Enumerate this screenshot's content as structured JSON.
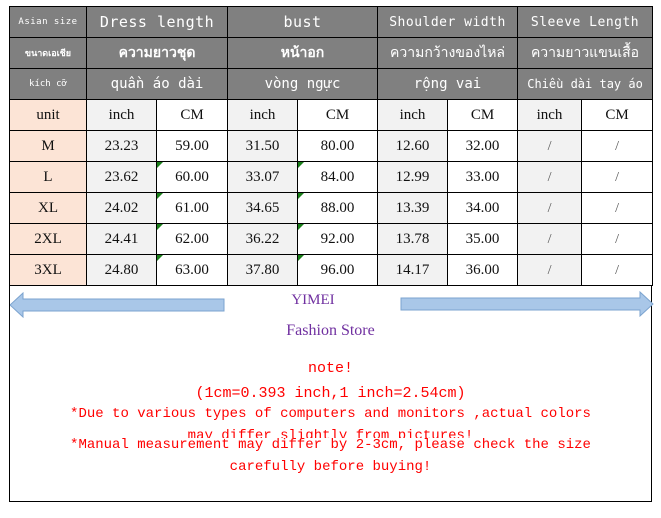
{
  "header": {
    "row1": {
      "label": "Asian size",
      "columns": [
        "Dress length",
        "bust",
        "Shoulder width",
        "Sleeve Length"
      ]
    },
    "row2": {
      "label": "ขนาดเอเชีย",
      "columns": [
        "ความยาวชุด",
        "หน้าอก",
        "ความกว้างของไหล่",
        "ความยาวแขนเสื้อ"
      ]
    },
    "row3": {
      "label": "kích cỡ",
      "columns": [
        "quần áo dài",
        "vòng ngực",
        "rộng vai",
        "Chiều dài tay áo"
      ]
    }
  },
  "units_row": [
    "unit",
    "inch",
    "CM",
    "inch",
    "CM",
    "inch",
    "CM",
    "inch",
    "CM"
  ],
  "rows": [
    {
      "size": "M",
      "values": [
        "23.23",
        "59.00",
        "31.50",
        "80.00",
        "12.60",
        "32.00",
        "/",
        "/"
      ]
    },
    {
      "size": "L",
      "values": [
        "23.62",
        "60.00",
        "33.07",
        "84.00",
        "12.99",
        "33.00",
        "/",
        "/"
      ]
    },
    {
      "size": "XL",
      "values": [
        "24.02",
        "61.00",
        "34.65",
        "88.00",
        "13.39",
        "34.00",
        "/",
        "/"
      ]
    },
    {
      "size": "2XL",
      "values": [
        "24.41",
        "62.00",
        "36.22",
        "92.00",
        "13.78",
        "35.00",
        "/",
        "/"
      ]
    },
    {
      "size": "3XL",
      "values": [
        "24.80",
        "63.00",
        "37.80",
        "96.00",
        "14.17",
        "36.00",
        "/",
        "/"
      ]
    }
  ],
  "brand": {
    "name": "YIMEI",
    "subtitle": "Fashion Store"
  },
  "notes": {
    "title": "note!",
    "conversion": "(1cm=0.393 inch,1 inch=2.54cm)",
    "line1a": "*Due to various types of computers and monitors ,actual colors",
    "line1b": "may differ slightly from pictures!",
    "line2a": "*Manual measurement may differ by 2-3cm, please check the size",
    "line2b": "carefully before  buying!"
  },
  "colors": {
    "header_bg": "#808080",
    "unit_bg": "#fce4d6",
    "inch_bg": "#f2f2f2",
    "brand": "#7030a0",
    "note": "#ff0000",
    "arrow": "#a9c7e8"
  }
}
